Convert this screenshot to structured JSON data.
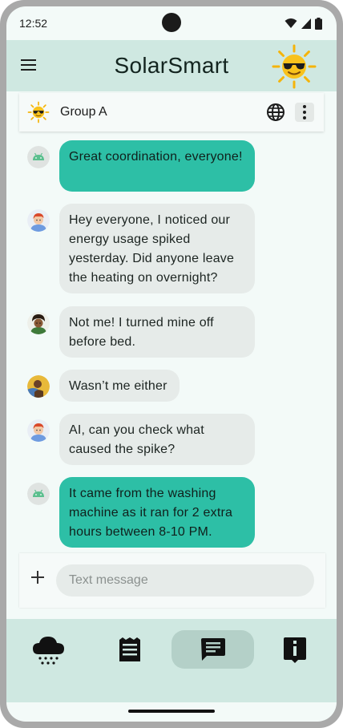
{
  "status_bar": {
    "time": "12:52",
    "icons": [
      "wifi-icon",
      "signal-icon",
      "battery-icon"
    ]
  },
  "app_bar": {
    "title": "SolarSmart",
    "menu_icon": "hamburger-menu-icon",
    "logo_icon": "sun-with-sunglasses-icon"
  },
  "group": {
    "name": "Group A",
    "icon": "sun-with-sunglasses-icon",
    "actions": [
      "globe-icon",
      "more-vert-icon"
    ]
  },
  "messages": [
    {
      "sender": "ai",
      "avatar": "android-icon",
      "text": "Great coordination, everyone!"
    },
    {
      "sender": "user",
      "avatar": "avatar-redhead-icon",
      "text": "Hey everyone, I noticed our energy usage spiked yesterday. Did anyone leave the heating on overnight?"
    },
    {
      "sender": "user",
      "avatar": "avatar-curly-icon",
      "text": "Not me! I turned mine off before bed."
    },
    {
      "sender": "user",
      "avatar": "avatar-gardener-icon",
      "text": "Wasn’t me either"
    },
    {
      "sender": "user",
      "avatar": "avatar-redhead-icon",
      "text": "AI, can you check what caused the spike?"
    },
    {
      "sender": "ai",
      "avatar": "android-icon",
      "text": "It came from the washing machine as it ran for 2 extra hours between 8-10 PM."
    }
  ],
  "composer": {
    "placeholder": "Text message",
    "value": "",
    "add_icon": "plus-icon"
  },
  "bottom_nav": {
    "items": [
      {
        "icon": "weather-rain-icon",
        "selected": false
      },
      {
        "icon": "notes-icon",
        "selected": false
      },
      {
        "icon": "chat-icon",
        "selected": true
      },
      {
        "icon": "info-icon",
        "selected": false
      }
    ]
  },
  "colors": {
    "app_bar_bg": "#cfe8e1",
    "ai_bubble": "#2dbfa6",
    "user_bubble": "#e6ebe9",
    "screen_bg": "#f3faf8",
    "nav_selected": "#b4d0c8"
  }
}
